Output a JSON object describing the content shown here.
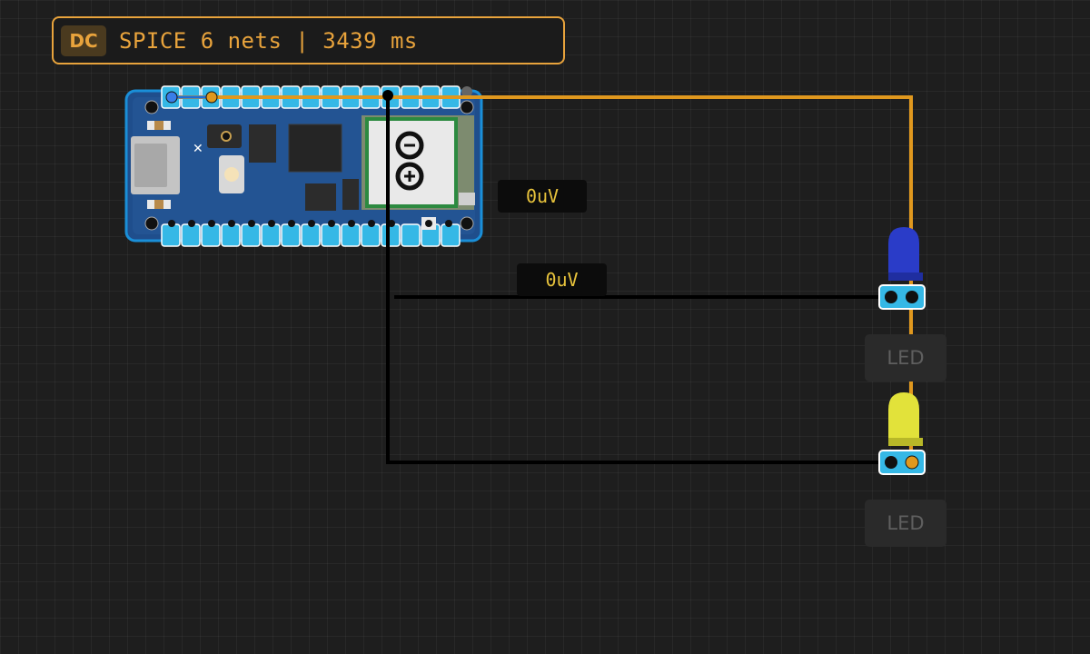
{
  "status_bar": {
    "mode_badge": "DC",
    "summary": "SPICE 6 nets | 3439 ms"
  },
  "probes": [
    {
      "reading": "0uV"
    },
    {
      "reading": "0uV"
    }
  ],
  "components": {
    "board": {
      "logo": "arduino-infinity-logo"
    },
    "leds": [
      {
        "label": "LED",
        "color": "#2a3cc8"
      },
      {
        "label": "LED",
        "color": "#e2e23a"
      }
    ]
  },
  "wires": {
    "colors": {
      "signal": "#e0981e",
      "ground": "#000000"
    }
  },
  "colors": {
    "accent": "#e8a33c",
    "board_blue": "#1f4e8c",
    "pin_cyan": "#35b8e6",
    "background": "#1e1e1e"
  }
}
